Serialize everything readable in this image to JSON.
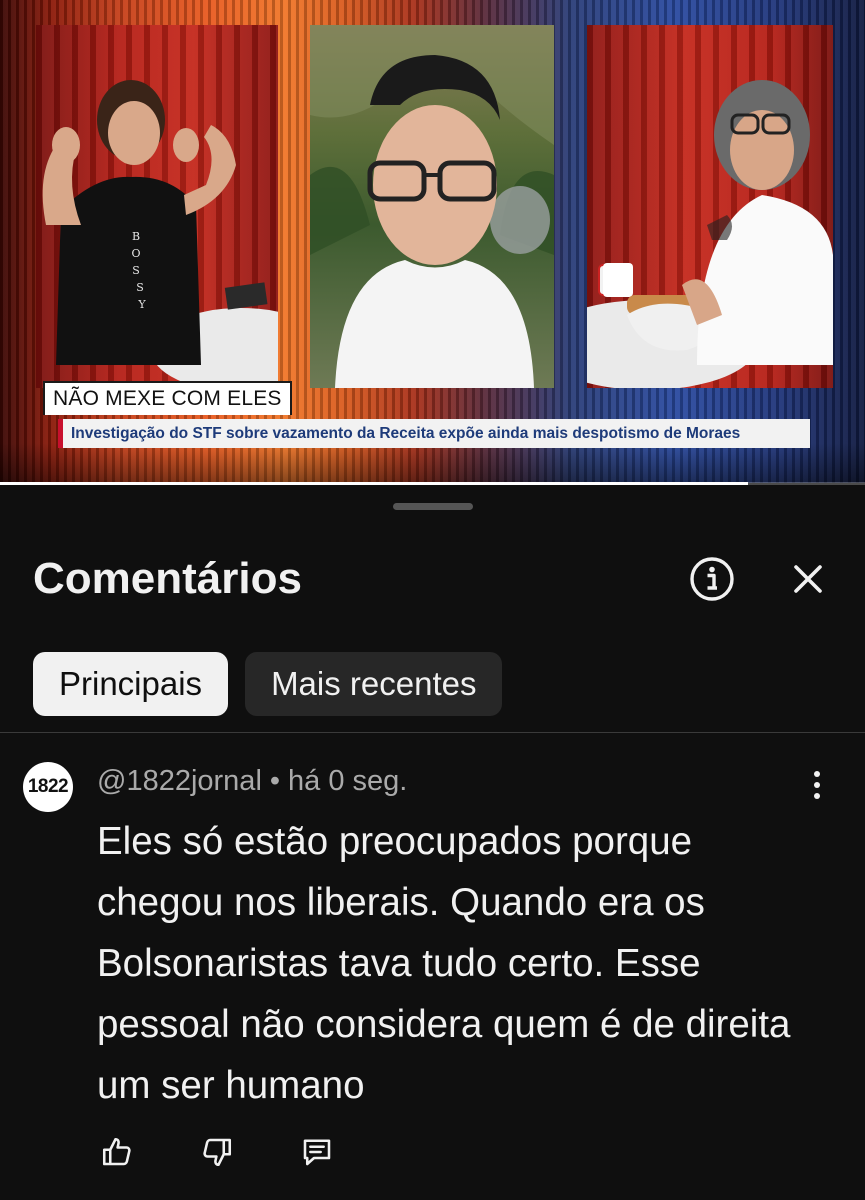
{
  "video": {
    "tag_label": "NÃO MEXE COM ELES",
    "headline": "Investigação do STF sobre vazamento da Receita expõe ainda mais despotismo de Moraes",
    "progress": 0.865,
    "shirt_text": "BOSSY"
  },
  "sheet": {
    "title": "Comentários",
    "icons": {
      "info": "info-icon",
      "close": "close-icon"
    },
    "chips": [
      {
        "label": "Principais",
        "active": true
      },
      {
        "label": "Mais recentes",
        "active": false
      }
    ]
  },
  "comment": {
    "avatar_text": "1822",
    "author": "@1822jornal",
    "separator": "•",
    "time": "há 0 seg.",
    "text": "Eles só estão preocupados porque chegou nos liberais. Quando era os Bolsonaristas tava tudo certo. Esse pessoal não considera quem é de direita um ser humano",
    "actions": [
      "like-icon",
      "dislike-icon",
      "reply-icon"
    ]
  },
  "colors": {
    "background": "#0f0f0f",
    "text": "#f1f1f1",
    "secondary_text": "#aaaaaa",
    "chip_active_bg": "#f1f1f1",
    "chip_inactive_bg": "#272727",
    "headline_text": "#1e3b7a"
  }
}
